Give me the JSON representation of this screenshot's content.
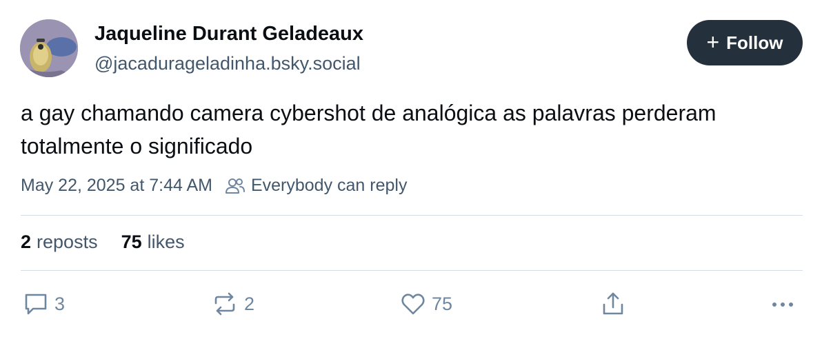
{
  "author": {
    "display_name": "Jaqueline Durant Geladeaux",
    "handle": "@jacaduragеladinha.bsky.social",
    "avatar_icon": "avatar-photo"
  },
  "follow_button": {
    "icon": "plus-icon",
    "label": "Follow"
  },
  "post": {
    "text": "a gay chamando camera cybershot de analógica as palavras perderam totalmente o significado",
    "timestamp": "May 22, 2025 at 7:44 AM",
    "reply_setting": "Everybody can reply"
  },
  "stats": {
    "reposts_count": "2",
    "reposts_label": "reposts",
    "likes_count": "75",
    "likes_label": "likes"
  },
  "actions": {
    "reply_count": "3",
    "repost_count": "2",
    "like_count": "75"
  },
  "colors": {
    "text_primary": "#0b0f14",
    "text_secondary": "#42576c",
    "icon_muted": "#6f869f",
    "follow_bg": "#25303d",
    "divider": "#d4dbe2"
  }
}
